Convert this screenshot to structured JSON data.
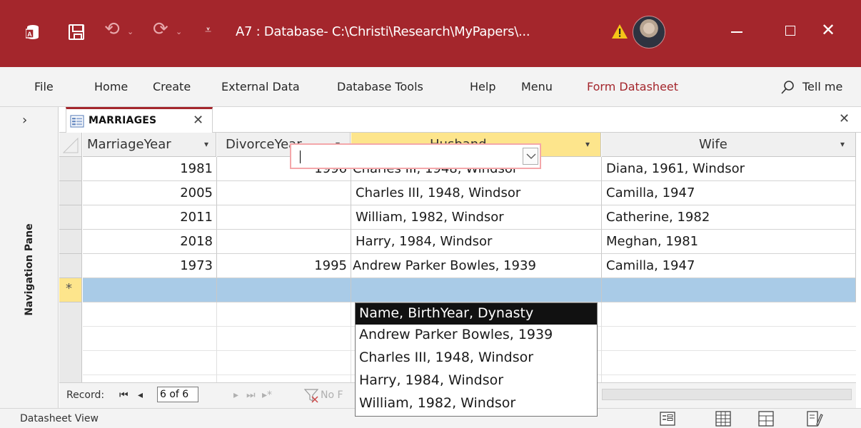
{
  "title": {
    "text": "A7 : Database- C:\\Christi\\Research\\MyPapers\\..."
  },
  "ribbon": {
    "tabs": [
      "File",
      "Home",
      "Create",
      "External Data",
      "Database Tools",
      "Help",
      "Menu"
    ],
    "contextual_tab": "Form Datasheet",
    "tell_me": "Tell me"
  },
  "nav_pane": {
    "label": "Navigation Pane"
  },
  "document_tab": {
    "label": "MARRIAGES"
  },
  "table": {
    "headers": [
      "MarriageYear",
      "DivorceYear",
      "Husband",
      "Wife"
    ],
    "rows": [
      {
        "marriage_year": "1981",
        "divorce_year": "1996",
        "husband": "Charles III, 1948, Windsor",
        "wife": "Diana, 1961, Windsor"
      },
      {
        "marriage_year": "2005",
        "divorce_year": "",
        "husband": "Charles III, 1948, Windsor",
        "wife": "Camilla, 1947"
      },
      {
        "marriage_year": "2011",
        "divorce_year": "",
        "husband": "William, 1982, Windsor",
        "wife": "Catherine, 1982"
      },
      {
        "marriage_year": "2018",
        "divorce_year": "",
        "husband": "Harry, 1984, Windsor",
        "wife": "Meghan, 1981"
      },
      {
        "marriage_year": "1973",
        "divorce_year": "1995",
        "husband": "Andrew Parker Bowles, 1939",
        "wife": "Camilla, 1947"
      }
    ],
    "new_record_symbol": "*"
  },
  "dropdown": {
    "items": [
      "Name, BirthYear, Dynasty",
      "Andrew Parker Bowles, 1939",
      "Charles III, 1948, Windsor",
      "Harry, 1984, Windsor",
      "William, 1982, Windsor"
    ],
    "selected_index": 0
  },
  "record_nav": {
    "label": "Record:",
    "current": "6 of 6",
    "filter_text": "No F"
  },
  "status": {
    "text": "Datasheet View"
  },
  "colors": {
    "accent": "#a4262c",
    "active_header": "#fde58c",
    "new_row": "#a9cbe7"
  }
}
